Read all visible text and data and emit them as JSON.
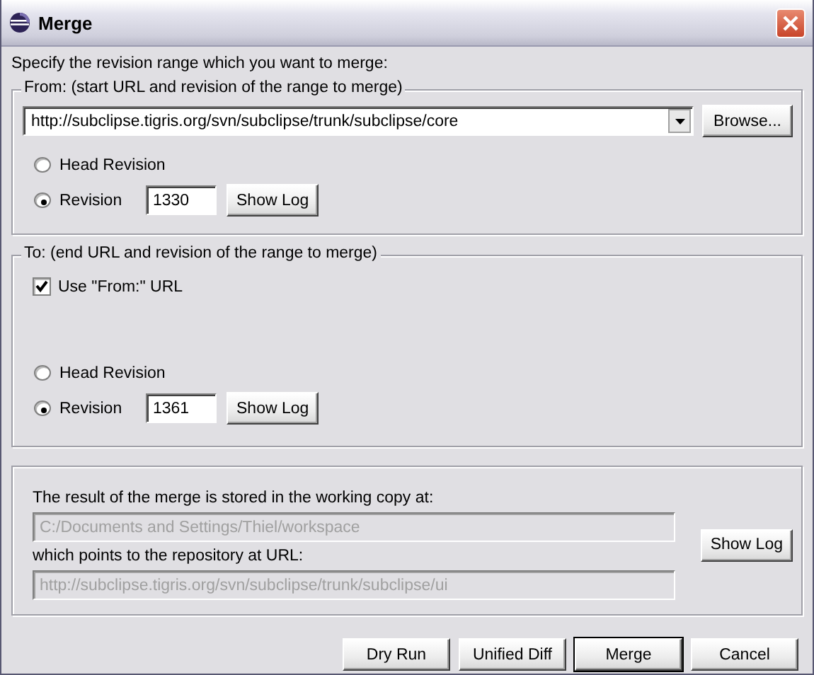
{
  "window": {
    "title": "Merge"
  },
  "instruction": "Specify the revision range which you want to merge:",
  "from": {
    "legend": "From: (start URL and revision of the range to merge)",
    "url": "http://subclipse.tigris.org/svn/subclipse/trunk/subclipse/core",
    "browse_button": "Browse...",
    "options": [
      {
        "label": "Head Revision",
        "selected": false
      },
      {
        "label": "Revision",
        "selected": true,
        "value": "1330",
        "button": "Show Log"
      }
    ]
  },
  "to": {
    "legend": "To: (end URL and revision of the range to merge)",
    "use_from_url": {
      "label": "Use \"From:\" URL",
      "checked": true
    },
    "options": [
      {
        "label": "Head Revision",
        "selected": false
      },
      {
        "label": "Revision",
        "selected": true,
        "value": "1361",
        "button": "Show Log"
      }
    ]
  },
  "result": {
    "working_copy_label": "The result of the merge is stored in the working copy at:",
    "working_copy_path": "C:/Documents and Settings/Thiel/workspace",
    "repository_label": "which points to the repository at URL:",
    "repository_url": "http://subclipse.tigris.org/svn/subclipse/trunk/subclipse/ui",
    "fields_disabled": true,
    "show_log_button": "Show Log"
  },
  "buttons": [
    {
      "label": "Dry Run",
      "default": false
    },
    {
      "label": "Unified Diff",
      "default": false
    },
    {
      "label": "Merge",
      "default": true
    },
    {
      "label": "Cancel",
      "default": false
    }
  ]
}
